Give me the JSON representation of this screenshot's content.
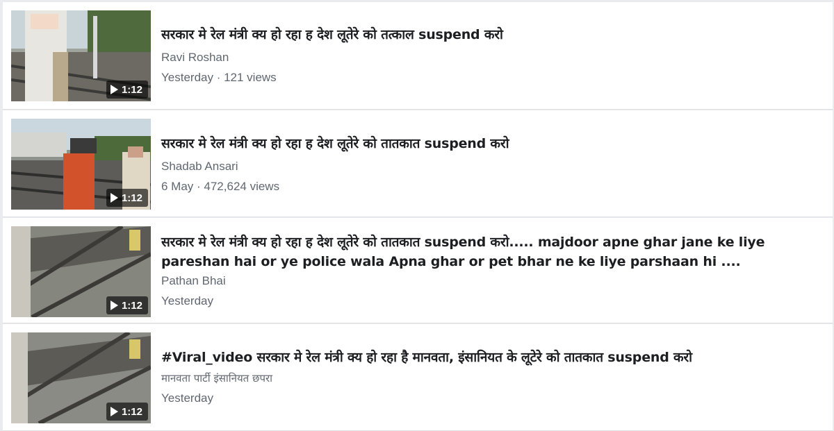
{
  "videos": [
    {
      "title": "सरकार मे रेल मंत्री क्य हो रहा ह देश लूतेरे को तत्काल suspend करो",
      "author": "Ravi Roshan",
      "meta": "Yesterday · 121 views",
      "duration": "1:12"
    },
    {
      "title": "सरकार मे रेल मंत्री क्य हो रहा ह देश लूतेरे को तातकात suspend करो",
      "author": "Shadab Ansari",
      "meta": "6 May · 472,624 views",
      "duration": "1:12"
    },
    {
      "title": "सरकार मे रेल मंत्री क्य हो रहा ह देश लूतेरे को तातकात suspend करो..... majdoor apne ghar jane ke liye pareshan hai or ye police wala Apna ghar or pet bhar ne ke liye parshaan hi ....",
      "author": "Pathan Bhai",
      "meta": "Yesterday",
      "duration": "1:12"
    },
    {
      "title": "#Viral_video सरकार मे रेल मंत्री क्य हो रहा है मानवता, इंसानियत के लूटेरे को तातकात suspend करो",
      "author": "मानवता पार्टी इंसानियत छपरा",
      "meta": "Yesterday",
      "duration": "1:12"
    }
  ],
  "colors": {
    "page_background": "#e9ebee",
    "card_background": "#ffffff",
    "title_text": "#1c1e21",
    "secondary_text": "#606770"
  },
  "icons": {
    "play": "play-icon"
  }
}
